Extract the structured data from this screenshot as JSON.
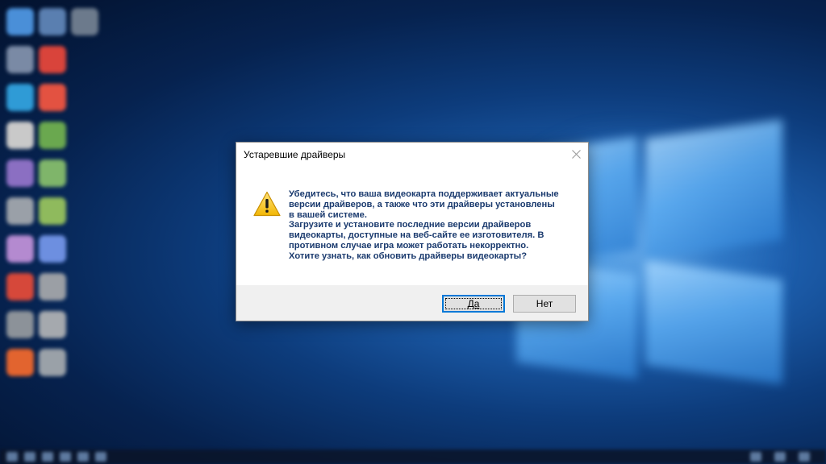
{
  "dialog": {
    "title": "Устаревшие драйверы",
    "close_icon": "close-icon",
    "warning_icon": "warning-triangle-icon",
    "message_lines": [
      "Убедитесь, что ваша видеокарта поддерживает актуальные",
      "версии драйверов, а также что эти драйверы установлены",
      "в вашей системе.",
      "Загрузите и установите последние версии драйверов",
      "видеокарты, доступные на веб-сайте ее изготовителя. В",
      "противном случае игра может работать некорректно.",
      "Хотите узнать, как обновить драйверы видеокарты?"
    ],
    "buttons": {
      "yes_label": "Да",
      "no_label": "Нет"
    },
    "colors": {
      "message_text": "#1a3a6e",
      "focus_border": "#0078d7",
      "footer_bg": "#f0f0f0",
      "warning_yellow": "#f7c52b"
    }
  },
  "desktop": {
    "wallpaper": "windows-10-hero-blurred"
  }
}
